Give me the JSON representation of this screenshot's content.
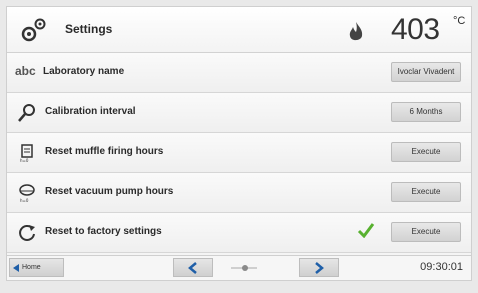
{
  "header": {
    "title": "Settings",
    "temperature": "403",
    "temperature_unit": "°C"
  },
  "rows": [
    {
      "prefix": "abc",
      "label": "Laboratory name",
      "button": "Ivoclar Vivadent"
    },
    {
      "label": "Calibration interval",
      "button": "6 Months"
    },
    {
      "label": "Reset muffle firing hours",
      "button": "Execute"
    },
    {
      "label": "Reset vacuum pump hours",
      "button": "Execute"
    },
    {
      "label": "Reset to factory settings",
      "button": "Execute"
    }
  ],
  "footer": {
    "home_label": "Home",
    "time": "09:30:01"
  },
  "icons": {
    "header": [
      "gears-icon",
      "flame-icon"
    ],
    "rows": [
      "text-abc-icon",
      "wrench-icon",
      "muffle-reset-icon",
      "vacuum-pump-reset-icon",
      "factory-reset-icon"
    ],
    "confirm": "checkmark-icon"
  },
  "colors": {
    "nav_arrow": "#1f5fa8",
    "check": "#58b130",
    "flame": "#444444"
  }
}
